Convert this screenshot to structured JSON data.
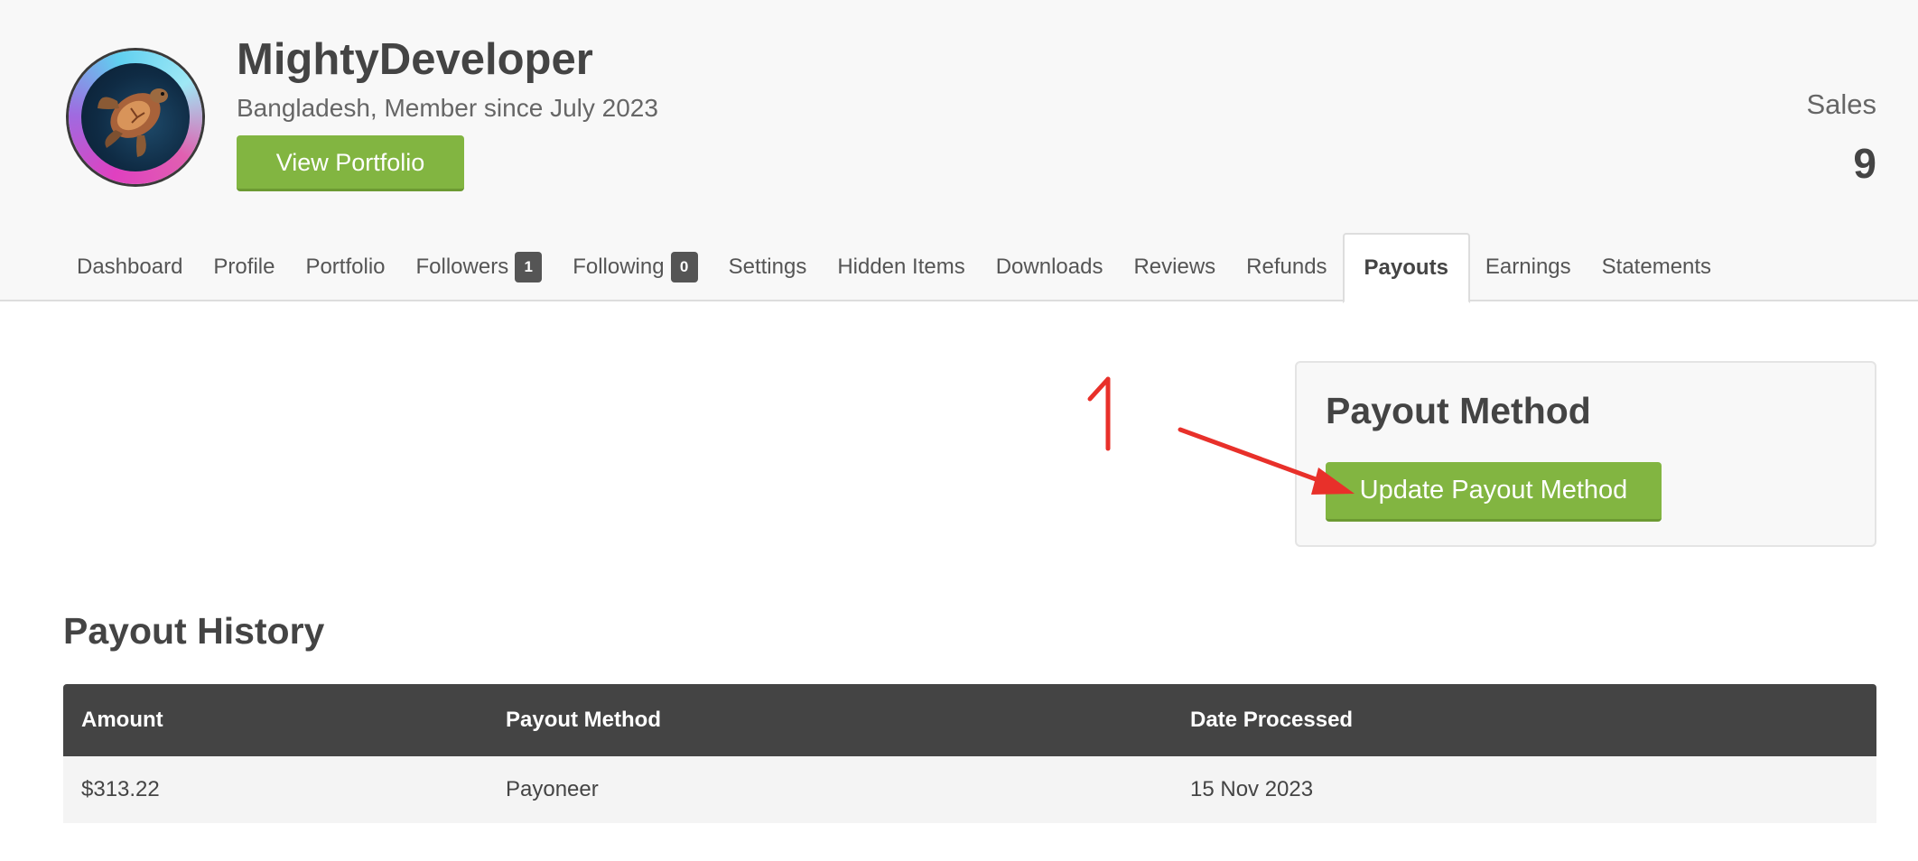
{
  "profile": {
    "username": "MightyDeveloper",
    "subtitle": "Bangladesh, Member since July 2023",
    "view_portfolio_label": "View Portfolio",
    "sales_label": "Sales",
    "sales_value": "9"
  },
  "tabs": [
    {
      "label": "Dashboard"
    },
    {
      "label": "Profile"
    },
    {
      "label": "Portfolio"
    },
    {
      "label": "Followers",
      "badge": "1"
    },
    {
      "label": "Following",
      "badge": "0"
    },
    {
      "label": "Settings"
    },
    {
      "label": "Hidden Items"
    },
    {
      "label": "Downloads"
    },
    {
      "label": "Reviews"
    },
    {
      "label": "Refunds"
    },
    {
      "label": "Payouts",
      "active": true
    },
    {
      "label": "Earnings"
    },
    {
      "label": "Statements"
    }
  ],
  "payout_method": {
    "title": "Payout Method",
    "button_label": "Update Payout Method"
  },
  "annotation": {
    "number": "1",
    "color": "#e8302a"
  },
  "payout_history": {
    "title": "Payout History",
    "columns": [
      "Amount",
      "Payout Method",
      "Date Processed"
    ],
    "rows": [
      [
        "$313.22",
        "Payoneer",
        "15 Nov 2023"
      ]
    ]
  },
  "colors": {
    "accent_green": "#82b541",
    "header_bg": "#f8f8f8",
    "table_header_bg": "#444444"
  }
}
